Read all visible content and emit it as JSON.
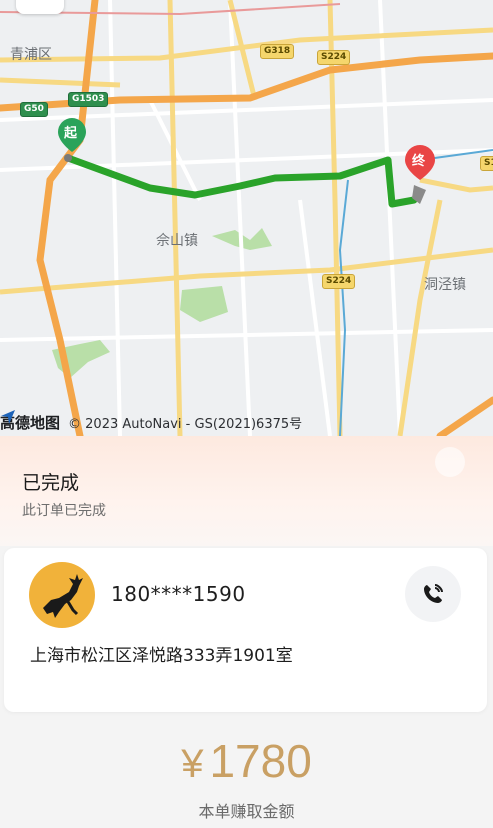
{
  "map": {
    "labels": {
      "qingpu": "青浦区",
      "sheshan": "佘山镇",
      "dongjing": "洞泾镇"
    },
    "shields": {
      "g318": "G318",
      "s224_top": "S224",
      "g50": "G50",
      "g1503": "G1503",
      "s224_mid": "S224",
      "s_right": "S1"
    },
    "start_marker": "起",
    "end_marker": "终",
    "attribution_logo": "高德地图",
    "attribution_text": "© 2023 AutoNavi - GS(2021)6375号",
    "route_color": "#2aa32a"
  },
  "status": {
    "title": "已完成",
    "subtitle": "此订单已完成"
  },
  "customer": {
    "phone": "180****1590",
    "address": "上海市松江区泽悦路333弄1901室"
  },
  "earnings": {
    "currency": "¥",
    "amount": "1780",
    "label": "本单赚取金额"
  },
  "colors": {
    "accent_gold": "#c9a064",
    "avatar_bg": "#f1b23a"
  }
}
